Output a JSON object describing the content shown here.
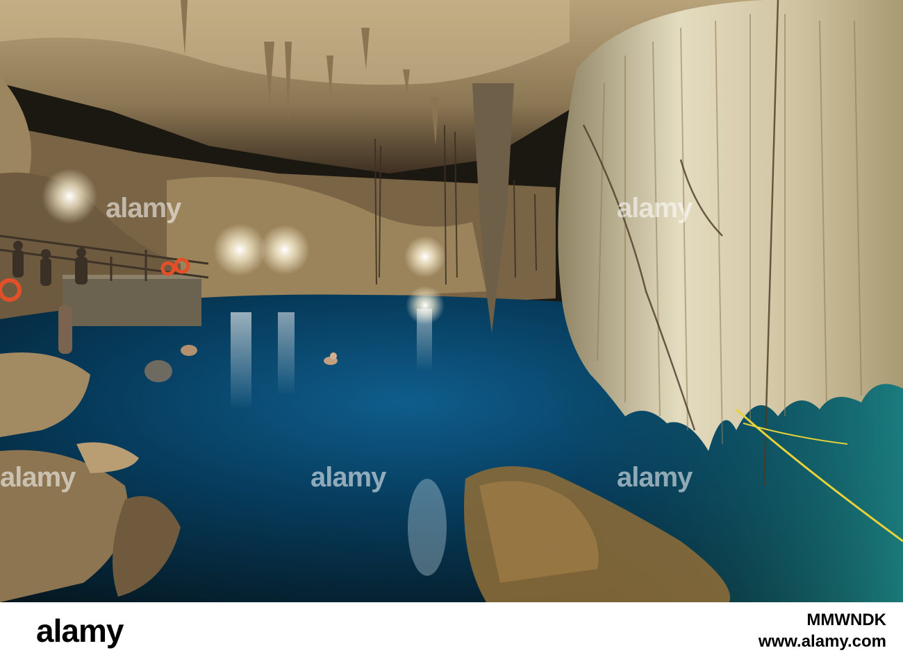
{
  "photo": {
    "subject": "cave-cenote-photo",
    "colors": {
      "water_deep": "#062a45",
      "water_light": "#1a7f8f",
      "rock_light": "#d9c9a8",
      "rock_dark": "#5a4630",
      "light_glow": "#fffbe8"
    }
  },
  "watermark": {
    "text": "alamy"
  },
  "footer": {
    "logo": "alamy",
    "image_id": "MMWNDK",
    "url": "www.alamy.com"
  }
}
